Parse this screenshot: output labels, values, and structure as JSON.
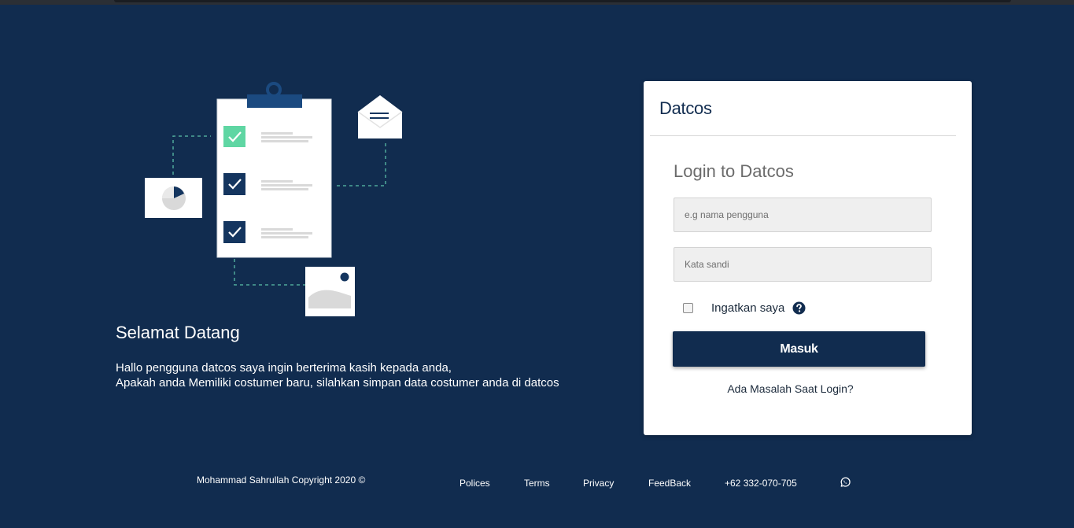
{
  "welcome": {
    "title": "Selamat Datang",
    "line1": "Hallo pengguna datcos saya ingin berterima kasih kepada anda,",
    "line2": "Apakah anda Memiliki costumer baru, silahkan simpan data costumer anda di datcos"
  },
  "card": {
    "brand": "Datcos",
    "form_title": "Login to Datcos",
    "username_placeholder": "e.g nama pengguna",
    "password_placeholder": "Kata sandi",
    "remember_label": "Ingatkan saya",
    "submit_label": "Masuk",
    "trouble_link": "Ada Masalah Saat Login?"
  },
  "footer": {
    "copyright": "Mohammad Sahrullah Copyright 2020 ©",
    "links": [
      "Polices",
      "Terms",
      "Privacy",
      "FeedBack",
      "+62 332-070-705"
    ],
    "social_icon": "whatsapp-icon"
  },
  "colors": {
    "background": "#112c4f",
    "card": "#ffffff",
    "accent_green": "#5fd6a3",
    "button": "#112c4f"
  }
}
